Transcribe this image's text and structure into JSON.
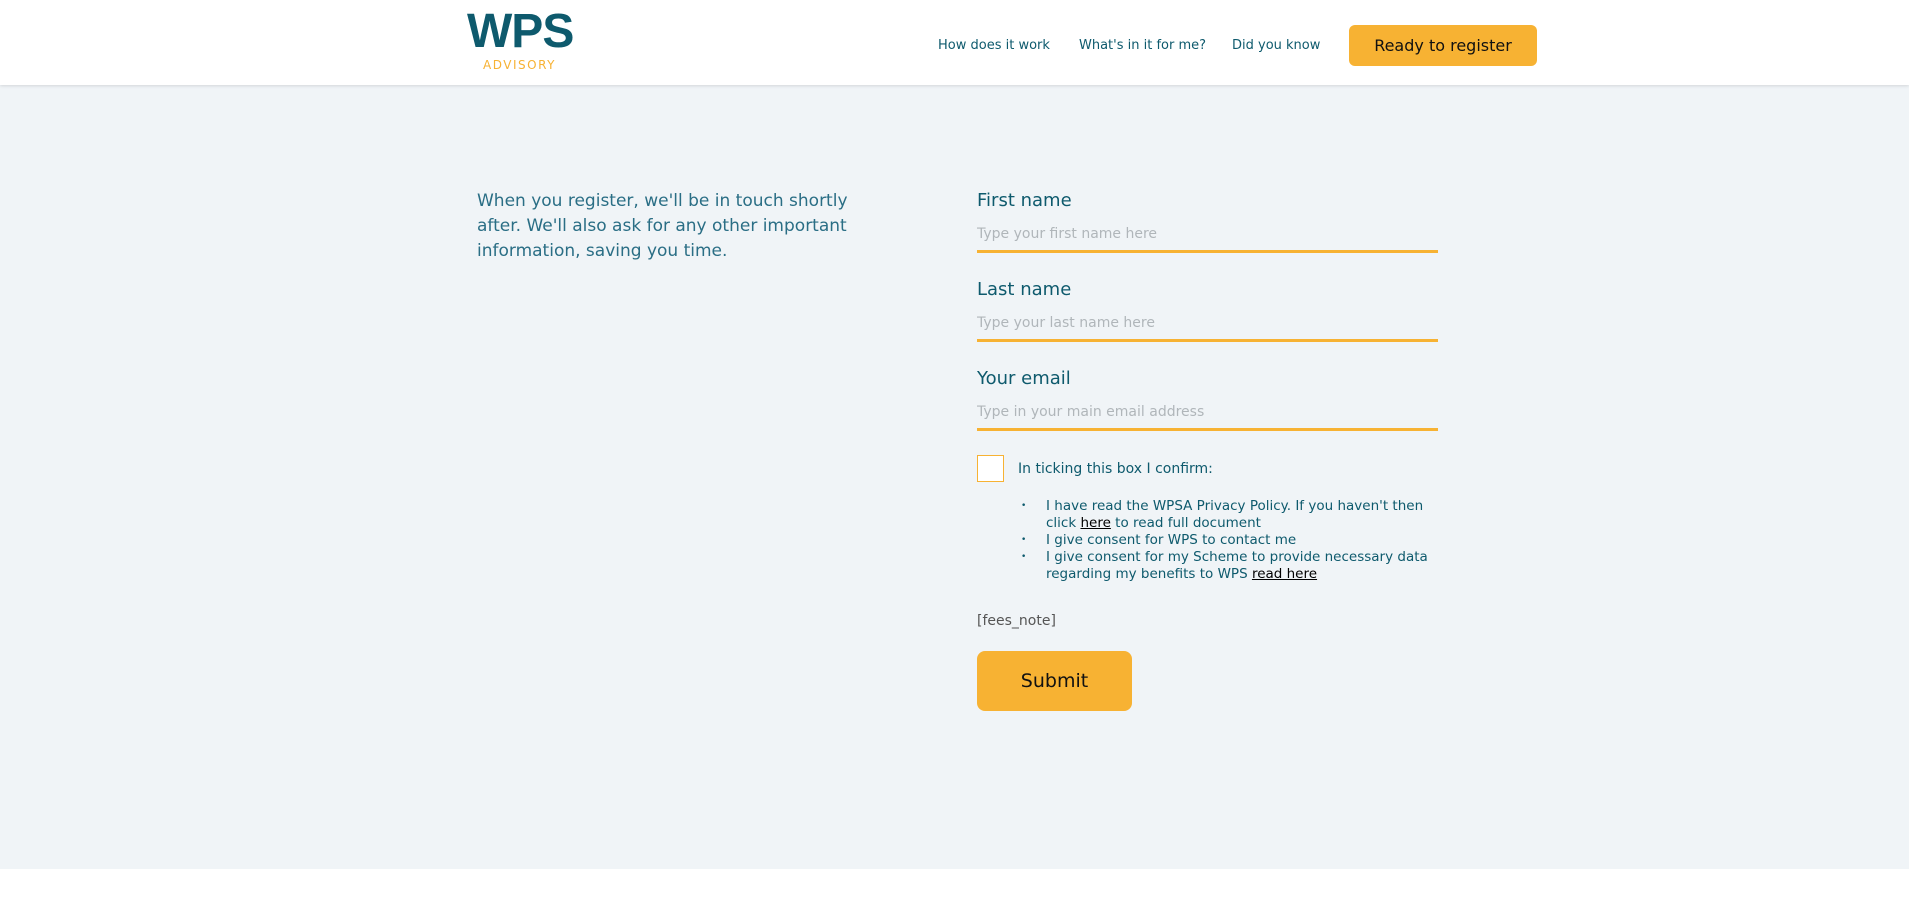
{
  "header": {
    "logo_main": "WPS",
    "logo_sub": "ADVISORY",
    "nav": [
      "How does it work",
      "What's in it for me?",
      "Did you know"
    ],
    "cta": "Ready to register"
  },
  "intro": "When you register, we'll be in touch shortly after. We'll also ask for any other important information, saving you time.",
  "form": {
    "first_name": {
      "label": "First name",
      "placeholder": "Type your first name here"
    },
    "last_name": {
      "label": "Last name",
      "placeholder": "Type your last name here"
    },
    "email": {
      "label": "Your email",
      "placeholder": "Type in your main email address"
    },
    "confirm": "In ticking this box I confirm:",
    "items": [
      {
        "pre": "I have read the WPSA Privacy Policy. If you haven't then click ",
        "link": "here",
        "post": " to read full document"
      },
      {
        "pre": "I give consent for WPS to contact me"
      },
      {
        "pre": "I give consent for my Scheme to provide necessary data regarding my benefits to WPS ",
        "link": "read here"
      }
    ],
    "fees_note": "[fees_note]",
    "submit": "Submit"
  },
  "colors": {
    "brand": "#0e5a6d",
    "accent": "#f7b233",
    "background": "#f0f4f7"
  }
}
